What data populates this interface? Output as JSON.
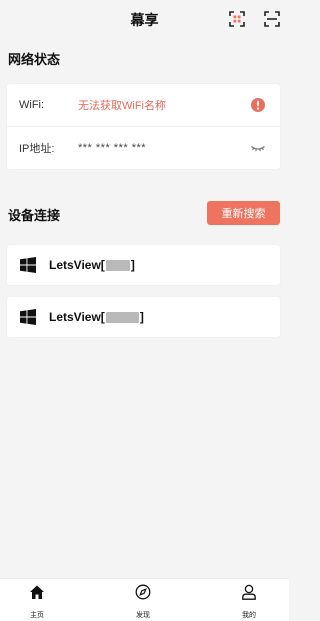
{
  "header": {
    "title": "幕享",
    "cast_icon": "screen-mirror-icon",
    "scan_icon": "scan-icon"
  },
  "network": {
    "title": "网络状态",
    "wifi_label": "WiFi:",
    "wifi_value": "无法获取WiFi名称",
    "wifi_status_icon": "error-icon",
    "ip_label": "IP地址:",
    "ip_value": "*** *** *** ***",
    "ip_toggle_icon": "eye-closed-icon"
  },
  "devices": {
    "title": "设备连接",
    "refresh_label": "重新搜索",
    "items": [
      {
        "name_prefix": "LetsView[",
        "name_suffix": "]",
        "icon": "windows-icon"
      },
      {
        "name_prefix": "LetsView[",
        "name_suffix": "]",
        "icon": "windows-icon"
      }
    ]
  },
  "bottom_nav": {
    "tabs": [
      {
        "label": "主页",
        "icon": "home-icon"
      },
      {
        "label": "发现",
        "icon": "compass-icon"
      },
      {
        "label": "我的",
        "icon": "user-icon"
      }
    ]
  },
  "colors": {
    "accent": "#ef7460",
    "error_text": "#e26a5a",
    "background": "#f4f4f4"
  }
}
